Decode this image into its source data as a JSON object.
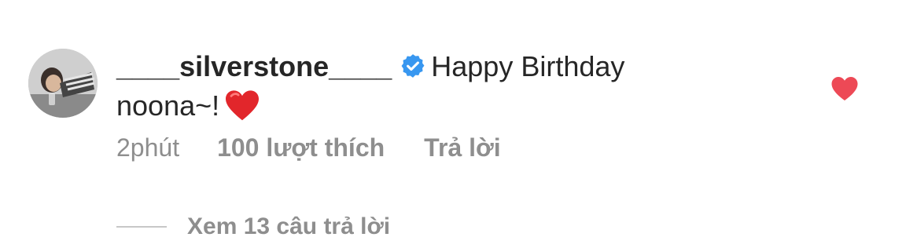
{
  "comment": {
    "username": "____silverstone____",
    "verified_icon": "verified-badge-icon",
    "text": "Happy Birthday noona~!",
    "emoji": "red-heart-emoji",
    "colors": {
      "verified": "#3897f0",
      "heart": "#ed4956",
      "muted": "#8e8e8e",
      "text": "#262626"
    }
  },
  "meta": {
    "time": "2phút",
    "likes": "100 lượt thích",
    "reply": "Trả lời"
  },
  "like_icon": "heart-filled-icon",
  "replies": {
    "label": "Xem 13 câu trả lời"
  }
}
